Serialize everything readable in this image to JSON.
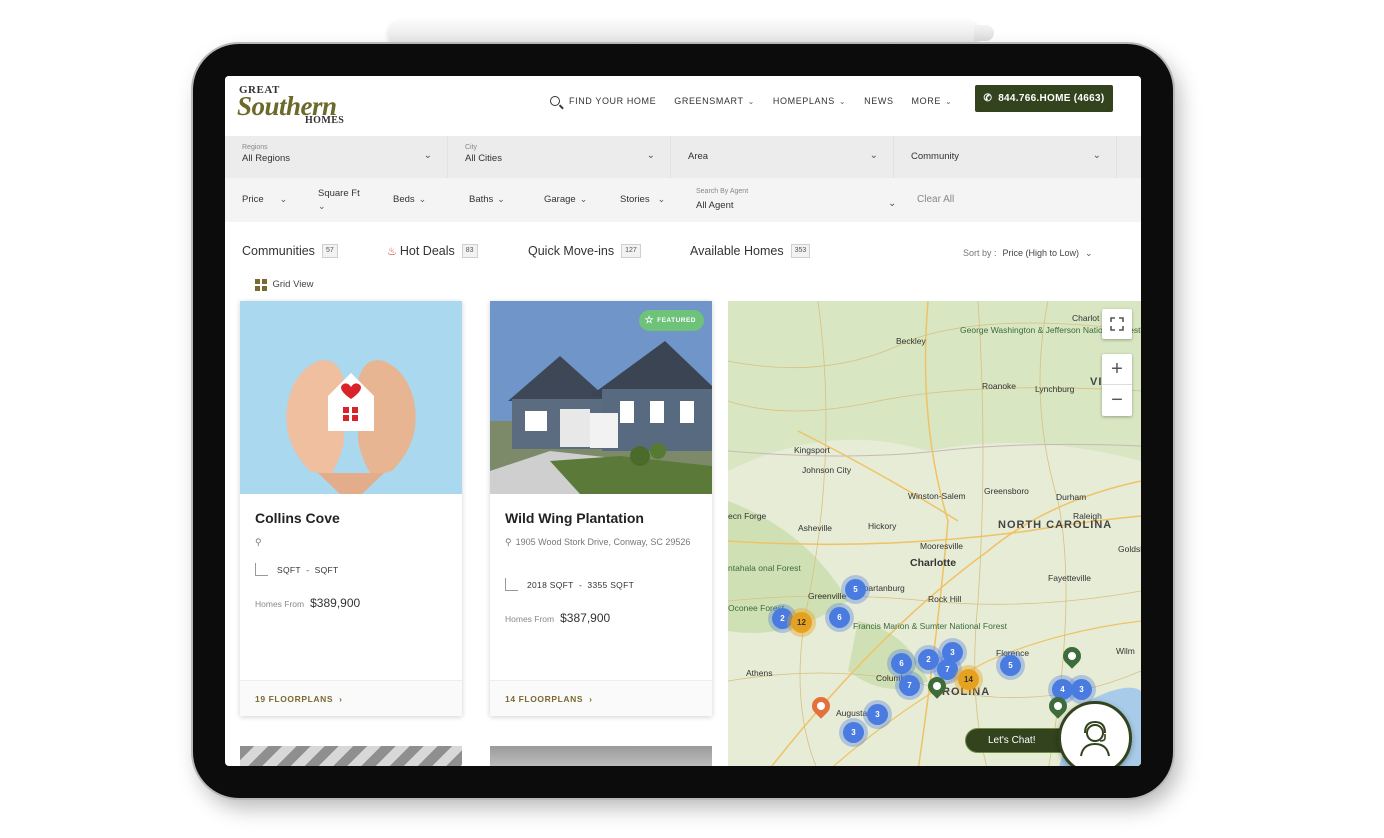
{
  "header": {
    "logo": {
      "line1": "GREAT",
      "line2": "Southern",
      "line3": "HOMES"
    },
    "nav": [
      {
        "label": "FIND YOUR HOME",
        "icon": "search-icon",
        "dropdown": false
      },
      {
        "label": "GREENSMART",
        "dropdown": true
      },
      {
        "label": "HOMEPLANS",
        "dropdown": true
      },
      {
        "label": "NEWS",
        "dropdown": false
      },
      {
        "label": "MORE",
        "dropdown": true
      }
    ],
    "phone": "844.766.HOME (4663)",
    "accent_color": "#33431e"
  },
  "filters": {
    "row1": [
      {
        "label": "Regions",
        "value": "All Regions"
      },
      {
        "label": "City",
        "value": "All Cities"
      },
      {
        "label": "",
        "value": "Area"
      },
      {
        "label": "",
        "value": "Community"
      }
    ],
    "row2": [
      "Price",
      "Square Ft",
      "Beds",
      "Baths",
      "Garage",
      "Stories"
    ],
    "agent_label": "Search By Agent",
    "agent_value": "All Agent",
    "clear": "Clear All"
  },
  "tabs": [
    {
      "label": "Communities",
      "count": "57"
    },
    {
      "label": "Hot Deals",
      "count": "83"
    },
    {
      "label": "Quick Move-ins",
      "count": "127"
    },
    {
      "label": "Available Homes",
      "count": "353"
    }
  ],
  "sort": {
    "label": "Sort by :",
    "value": "Price (High to Low)"
  },
  "view_toggle": "Grid View",
  "cards": [
    {
      "title": "Collins Cove",
      "address": "",
      "sqft_min": "SQFT",
      "sqft_max": "SQFT",
      "homes_from_label": "Homes From",
      "price": "$389,900",
      "floorplans": "19 FLOORPLANS",
      "featured": false
    },
    {
      "title": "Wild Wing Plantation",
      "address": "1905 Wood Stork Drive, Conway, SC 29526",
      "sqft_min": "2018 SQFT",
      "sqft_max": "3355 SQFT",
      "homes_from_label": "Homes From",
      "price": "$387,900",
      "floorplans": "14 FLOORPLANS",
      "featured": true,
      "featured_label": "FEATURED"
    }
  ],
  "map": {
    "labels": [
      "Charlot",
      "Beckley",
      "George Washington & Jefferson National Forest",
      "Roanoke",
      "Lynchburg",
      "VIR",
      "Kingsport",
      "Johnson City",
      "Winston-Salem",
      "Greensboro",
      "Durham",
      "Raleigh",
      "ecn Forge",
      "Asheville",
      "Hickory",
      "NORTH CAROLINA",
      "Goldsb",
      "Mooresville",
      "Charlotte",
      "ntahala onal Forest",
      "Fayetteville",
      "Greenville",
      "Spartanburg",
      "Rock Hill",
      "Oconee Forest",
      "Francis Marion & Sumter National Forest",
      "Florence",
      "Wilm",
      "Athens",
      "Columbia",
      "ROLINA",
      "Augusta"
    ],
    "clusters": [
      "5",
      "6",
      "2",
      "12",
      "6",
      "2",
      "3",
      "7",
      "7",
      "5",
      "14",
      "4",
      "3",
      "3",
      "3"
    ],
    "chat_label": "Let's Chat!"
  }
}
